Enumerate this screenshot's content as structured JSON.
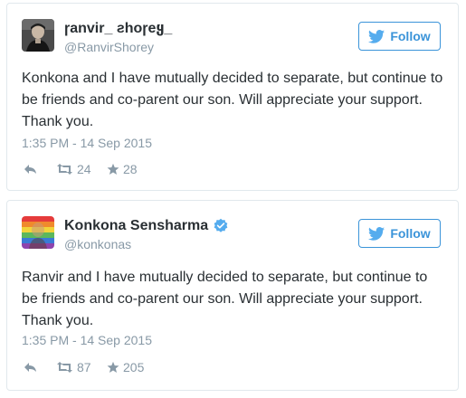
{
  "colors": {
    "follow_blue": "#3b94d9",
    "verified_blue": "#55acee",
    "meta_gray": "#8899a6",
    "text": "#292f33",
    "border": "#e1e8ed"
  },
  "tweets": [
    {
      "display_name": "ɼanvir_ ƨhoɼeყ_",
      "handle": "@RanvirShorey",
      "verified": false,
      "follow_label": "Follow",
      "text": "Konkona and I have mutually decided to separate, but continue to be friends and co-parent our son. Will appreciate your support. Thank you.",
      "timestamp": "1:35 PM - 14 Sep 2015",
      "retweets": "24",
      "likes": "28"
    },
    {
      "display_name": "Konkona Sensharma",
      "handle": "@konkonas",
      "verified": true,
      "follow_label": "Follow",
      "text": "Ranvir and I have mutually decided to separate, but continue to be friends and co-parent our son. Will appreciate your support. Thank you.",
      "timestamp": "1:35 PM - 14 Sep 2015",
      "retweets": "87",
      "likes": "205"
    }
  ]
}
